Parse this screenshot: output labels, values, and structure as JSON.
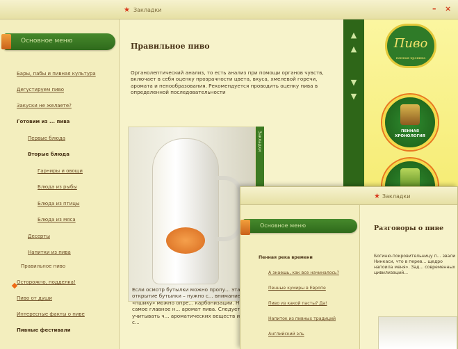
{
  "window1": {
    "title": "Закладки",
    "close_symbol": "×",
    "minimize_symbol": "–",
    "menu_header": "Основное меню",
    "nav": [
      "Бары, пабы и пивная культура",
      "Дегустируем пиво",
      "Закуски не желаете?",
      "Готовим из ... пива",
      "Первые блюда",
      "Вторые блюда",
      "Гарниры и овощи",
      "Блюда из рыбы",
      "Блюда из птицы",
      "Блюда из мяса",
      "Десерты",
      "Напитки из пива",
      "Правильное пиво",
      "Осторожно, подделка!",
      "Пиво от души",
      "Интересные факты о пиве",
      "Пивные фестивали"
    ],
    "content_title": "Правильное пиво",
    "intro_text": "Органолептический анализ, то есть анализ при помощи органов чувств, включает в себя оценку прозрачности цвета, вкуса, хмелевой горечи, аромата и пенообразования. Рекомендуется проводить оценку пива в определенной последовательности",
    "bottom_text": "Если осмотр бутылки можно пропу... этап – открытие бутылки – нужно с... внимание. По «пшику» можно опре... карбонизации. Но самое главное н... аромат пива. Следует учитывать ч... ароматических веществ имеют с...",
    "side_tab_label": "Закладки",
    "scroll_up": "▲",
    "scroll_down": "▼",
    "right_panel": {
      "logo_text": "Пиво",
      "logo_sub": "пенная хроника",
      "badge1_label": "ПЕННАЯ ХРОНОЛОГИЯ"
    }
  },
  "window2": {
    "title": "Закладки",
    "menu_header": "Основное меню",
    "nav": [
      "Пенная река времени",
      "А знаешь, как все начиналось?",
      "Пенные кумиры в Европе",
      "Пиво из какой пасты? Да!",
      "Напиток из пивных традиций",
      "Английский эль"
    ],
    "content_title": "Разговоры о пиве",
    "intro_text": "Богиню-покровительницу п... звали Нинкаси, что в перев... щедро напоила меня». Зад... современных цивилизаций..."
  }
}
